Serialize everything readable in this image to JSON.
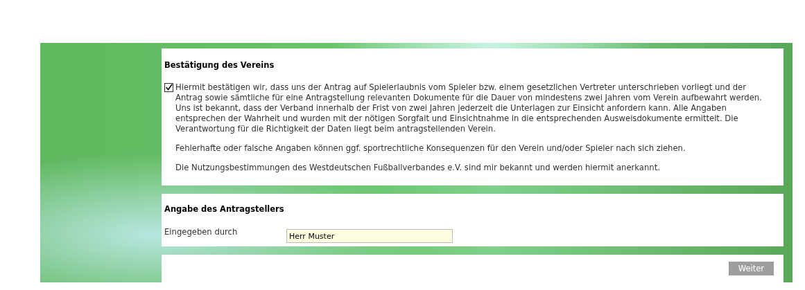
{
  "confirmation": {
    "heading": "Bestätigung des Vereins",
    "checkbox": {
      "checked": true,
      "text": "Hiermit bestätigen wir, dass uns der Antrag auf Spielerlaubnis vom Spieler bzw. einem gesetzlichen Vertreter unterschrieben vorliegt und der Antrag sowie sämtliche für eine Antragstellung relevanten Dokumente für die Dauer von mindestens zwei Jahren vom Verein aufbewahrt werden. Uns ist bekannt, dass der Verband innerhalb der Frist von zwei Jahren jederzeit die Unterlagen zur Einsicht anfordern kann. Alle Angaben entsprechen der Wahrheit und wurden mit der nötigen Sorgfalt und Einsichtnahme in die entsprechenden Ausweisdokumente ermittelt. Die Verantwortung für die Richtigkeit der Daten liegt beim antragstellenden Verein."
    },
    "paragraphs": [
      "Fehlerhafte oder falsche Angaben können ggf. sportrechtliche Konsequenzen für den Verein und/oder Spieler nach sich ziehen.",
      "Die Nutzungsbestimmungen des Westdeutschen Fußballverbandes e.V. sind mir bekannt und werden hiermit anerkannt."
    ]
  },
  "applicant": {
    "heading": "Angabe des Antragstellers",
    "field": {
      "label": "Eingegeben durch",
      "value": "Herr Muster"
    }
  },
  "buttons": [
    {
      "label": "Weiter",
      "disabled": true
    }
  ]
}
